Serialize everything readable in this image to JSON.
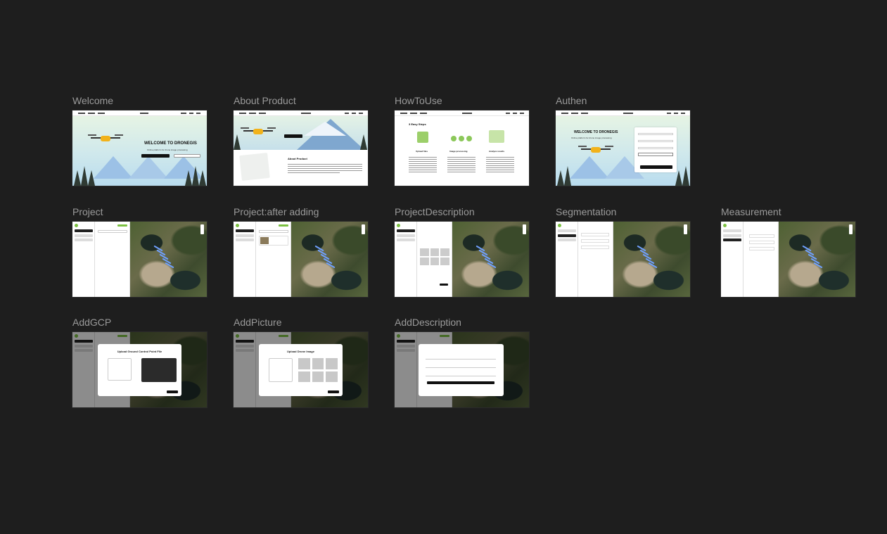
{
  "frames": [
    {
      "id": "welcome",
      "label": "Welcome"
    },
    {
      "id": "about",
      "label": "About Product"
    },
    {
      "id": "howto",
      "label": "HowToUse"
    },
    {
      "id": "authen",
      "label": "Authen"
    },
    {
      "id": "project",
      "label": "Project"
    },
    {
      "id": "project-after",
      "label": "Project:after adding"
    },
    {
      "id": "project-desc",
      "label": "ProjectDescription"
    },
    {
      "id": "segmentation",
      "label": "Segmentation"
    },
    {
      "id": "measurement",
      "label": "Measurement"
    },
    {
      "id": "addgcp",
      "label": "AddGCP"
    },
    {
      "id": "addpicture",
      "label": "AddPicture"
    },
    {
      "id": "adddescription",
      "label": "AddDescription"
    }
  ],
  "thumbs": {
    "welcome_headline": "WELCOME TO DRONEGIS",
    "welcome_sub": "Online platform for drone image processing",
    "about_title": "About Product",
    "howto_title": "3 Easy Steps",
    "howto_steps": [
      "Upload files",
      "Image processing",
      "Analyze results"
    ],
    "authen_headline": "WELCOME TO DRONEGIS",
    "authen_sub": "Online platform for drone image processing",
    "gcp_modal_title": "Upload Ground Control Point File",
    "picture_modal_title": "Upload Drone Image"
  },
  "colors": {
    "canvas": "#1e1e1e",
    "label": "#9a9a9a",
    "accent_green": "#7cc142"
  }
}
